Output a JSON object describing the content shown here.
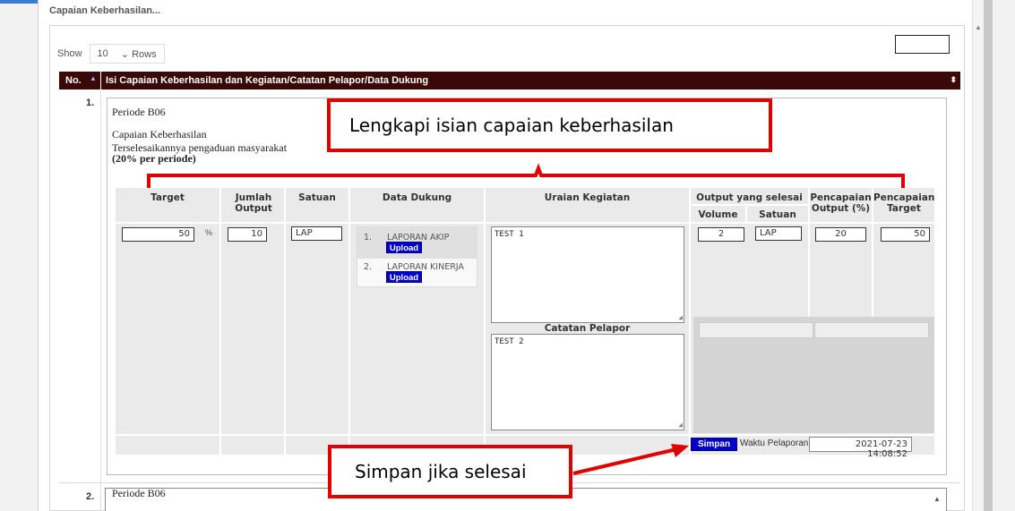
{
  "panel": {
    "title": "Capaian Keberhasilan..."
  },
  "show": {
    "prefix": "Show",
    "value": "10",
    "suffix": "Rows"
  },
  "table_header": {
    "no": "No.",
    "isi": "Isi Capaian Keberhasilan dan Kegiatan/Catatan Pelapor/Data Dukung"
  },
  "rows": [
    {
      "no": "1.",
      "periode": "Periode B06",
      "capaian_label": "Capaian Keberhasilan",
      "capaian_desc": "Terselesaikannya pengaduan masyarakat",
      "capaian_pct": "(20% per periode)",
      "columns": {
        "target": "Target",
        "jumlah_output": "Jumlah Output",
        "satuan": "Satuan",
        "data_dukung": "Data Dukung",
        "uraian_kegiatan": "Uraian Kegiatan",
        "output_selesai": "Output yang selesai",
        "volume": "Volume",
        "satuan2": "Satuan",
        "pencapaian_output": "Pencapaian Output (%)",
        "pencapaian_target": "Pencapaian Target"
      },
      "values": {
        "target": "50",
        "target_unit": "%",
        "jumlah_output": "10",
        "satuan": "LAP",
        "uraian_kegiatan": "TEST 1",
        "catatan_label": "Catatan Pelapor",
        "catatan_pelapor": "TEST 2",
        "volume": "2",
        "satuan_output": "LAP",
        "pencapaian_output": "20",
        "pencapaian_target": "50"
      },
      "data_dukung": [
        {
          "num": "1.",
          "label": "LAPORAN AKIP",
          "button": "Upload"
        },
        {
          "num": "2.",
          "label": "LAPORAN KINERJA",
          "button": "Upload"
        }
      ],
      "save_button": "Simpan",
      "waktu_label": "Waktu Pelaporan",
      "waktu_value": "2021-07-23 14:08:52"
    },
    {
      "no": "2.",
      "periode": "Periode B06"
    }
  ],
  "annotations": {
    "callout1": "Lengkapi isian capaian keberhasilan",
    "callout2": "Simpan jika selesai",
    "color": "#e00000"
  },
  "colors": {
    "header_bg": "#3b0808",
    "button_blue": "#0000cc"
  }
}
